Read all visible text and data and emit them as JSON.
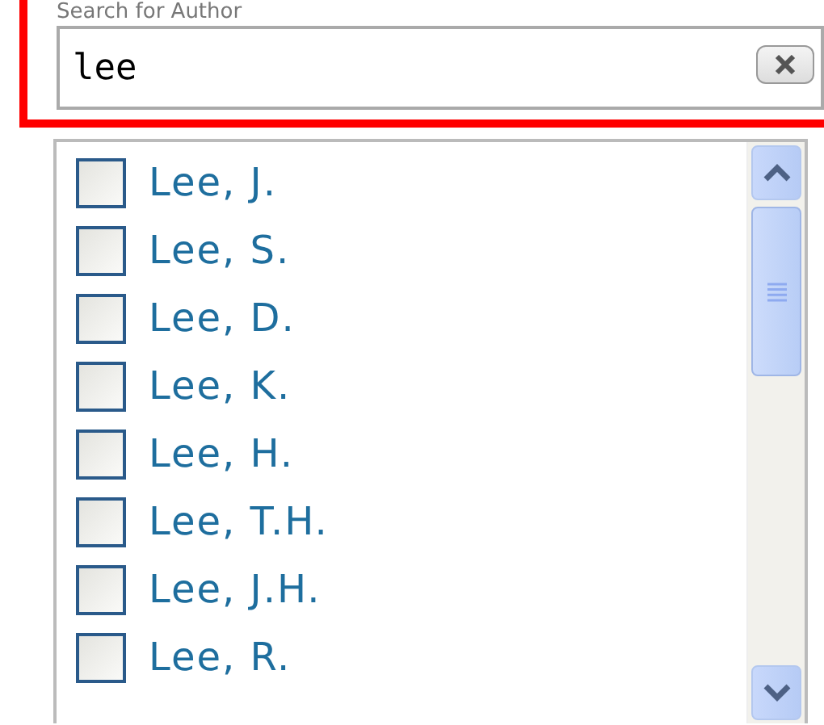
{
  "search": {
    "label": "Search for Author",
    "value": "lee"
  },
  "authors": [
    {
      "name": "Lee, J.",
      "checked": false
    },
    {
      "name": "Lee, S.",
      "checked": false
    },
    {
      "name": "Lee, D.",
      "checked": false
    },
    {
      "name": "Lee, K.",
      "checked": false
    },
    {
      "name": "Lee, H.",
      "checked": false
    },
    {
      "name": "Lee, T.H.",
      "checked": false
    },
    {
      "name": "Lee, J.H.",
      "checked": false
    },
    {
      "name": "Lee, R.",
      "checked": false
    }
  ]
}
